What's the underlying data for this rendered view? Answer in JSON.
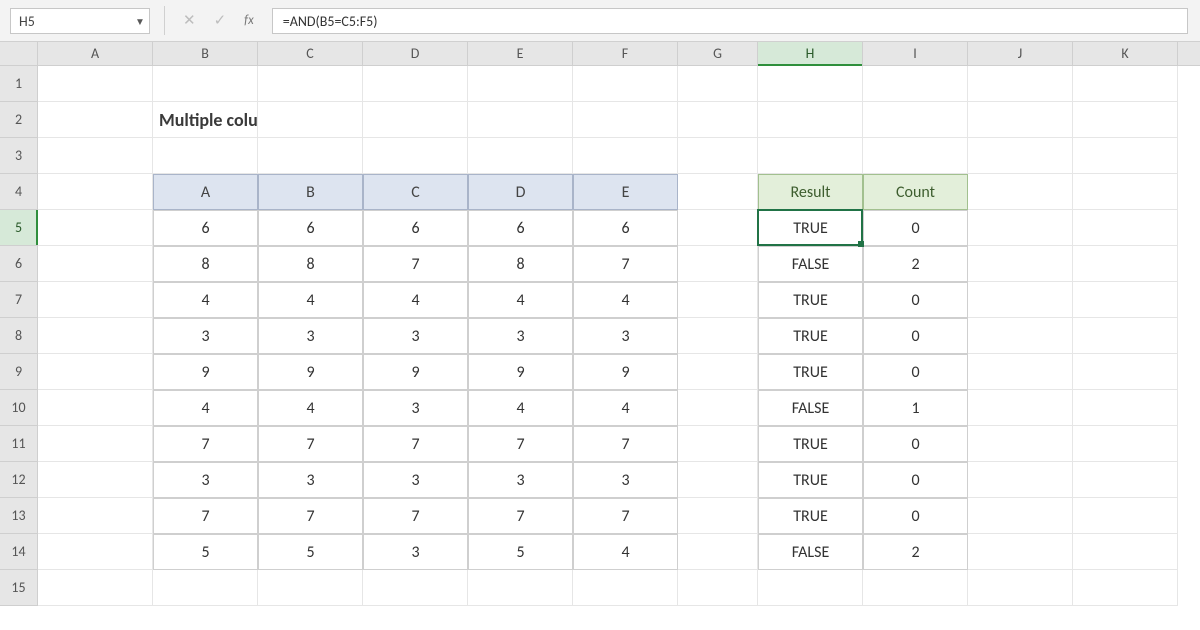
{
  "formula_bar": {
    "name_box": "H5",
    "formula": "=AND(B5=C5:F5)",
    "fx_label": "fx"
  },
  "column_headers": [
    "A",
    "B",
    "C",
    "D",
    "E",
    "F",
    "G",
    "H",
    "I",
    "J",
    "K"
  ],
  "row_headers": [
    "1",
    "2",
    "3",
    "4",
    "5",
    "6",
    "7",
    "8",
    "9",
    "10",
    "11",
    "12",
    "13",
    "14",
    "15"
  ],
  "active": {
    "col": "H",
    "row": "5"
  },
  "title": "Multiple columns are equal",
  "data_table": {
    "headers": [
      "A",
      "B",
      "C",
      "D",
      "E"
    ],
    "rows": [
      [
        "6",
        "6",
        "6",
        "6",
        "6"
      ],
      [
        "8",
        "8",
        "7",
        "8",
        "7"
      ],
      [
        "4",
        "4",
        "4",
        "4",
        "4"
      ],
      [
        "3",
        "3",
        "3",
        "3",
        "3"
      ],
      [
        "9",
        "9",
        "9",
        "9",
        "9"
      ],
      [
        "4",
        "4",
        "3",
        "4",
        "4"
      ],
      [
        "7",
        "7",
        "7",
        "7",
        "7"
      ],
      [
        "3",
        "3",
        "3",
        "3",
        "3"
      ],
      [
        "7",
        "7",
        "7",
        "7",
        "7"
      ],
      [
        "5",
        "5",
        "3",
        "5",
        "4"
      ]
    ]
  },
  "result_table": {
    "headers": [
      "Result",
      "Count"
    ],
    "rows": [
      [
        "TRUE",
        "0"
      ],
      [
        "FALSE",
        "2"
      ],
      [
        "TRUE",
        "0"
      ],
      [
        "TRUE",
        "0"
      ],
      [
        "TRUE",
        "0"
      ],
      [
        "FALSE",
        "1"
      ],
      [
        "TRUE",
        "0"
      ],
      [
        "TRUE",
        "0"
      ],
      [
        "TRUE",
        "0"
      ],
      [
        "FALSE",
        "2"
      ]
    ]
  }
}
